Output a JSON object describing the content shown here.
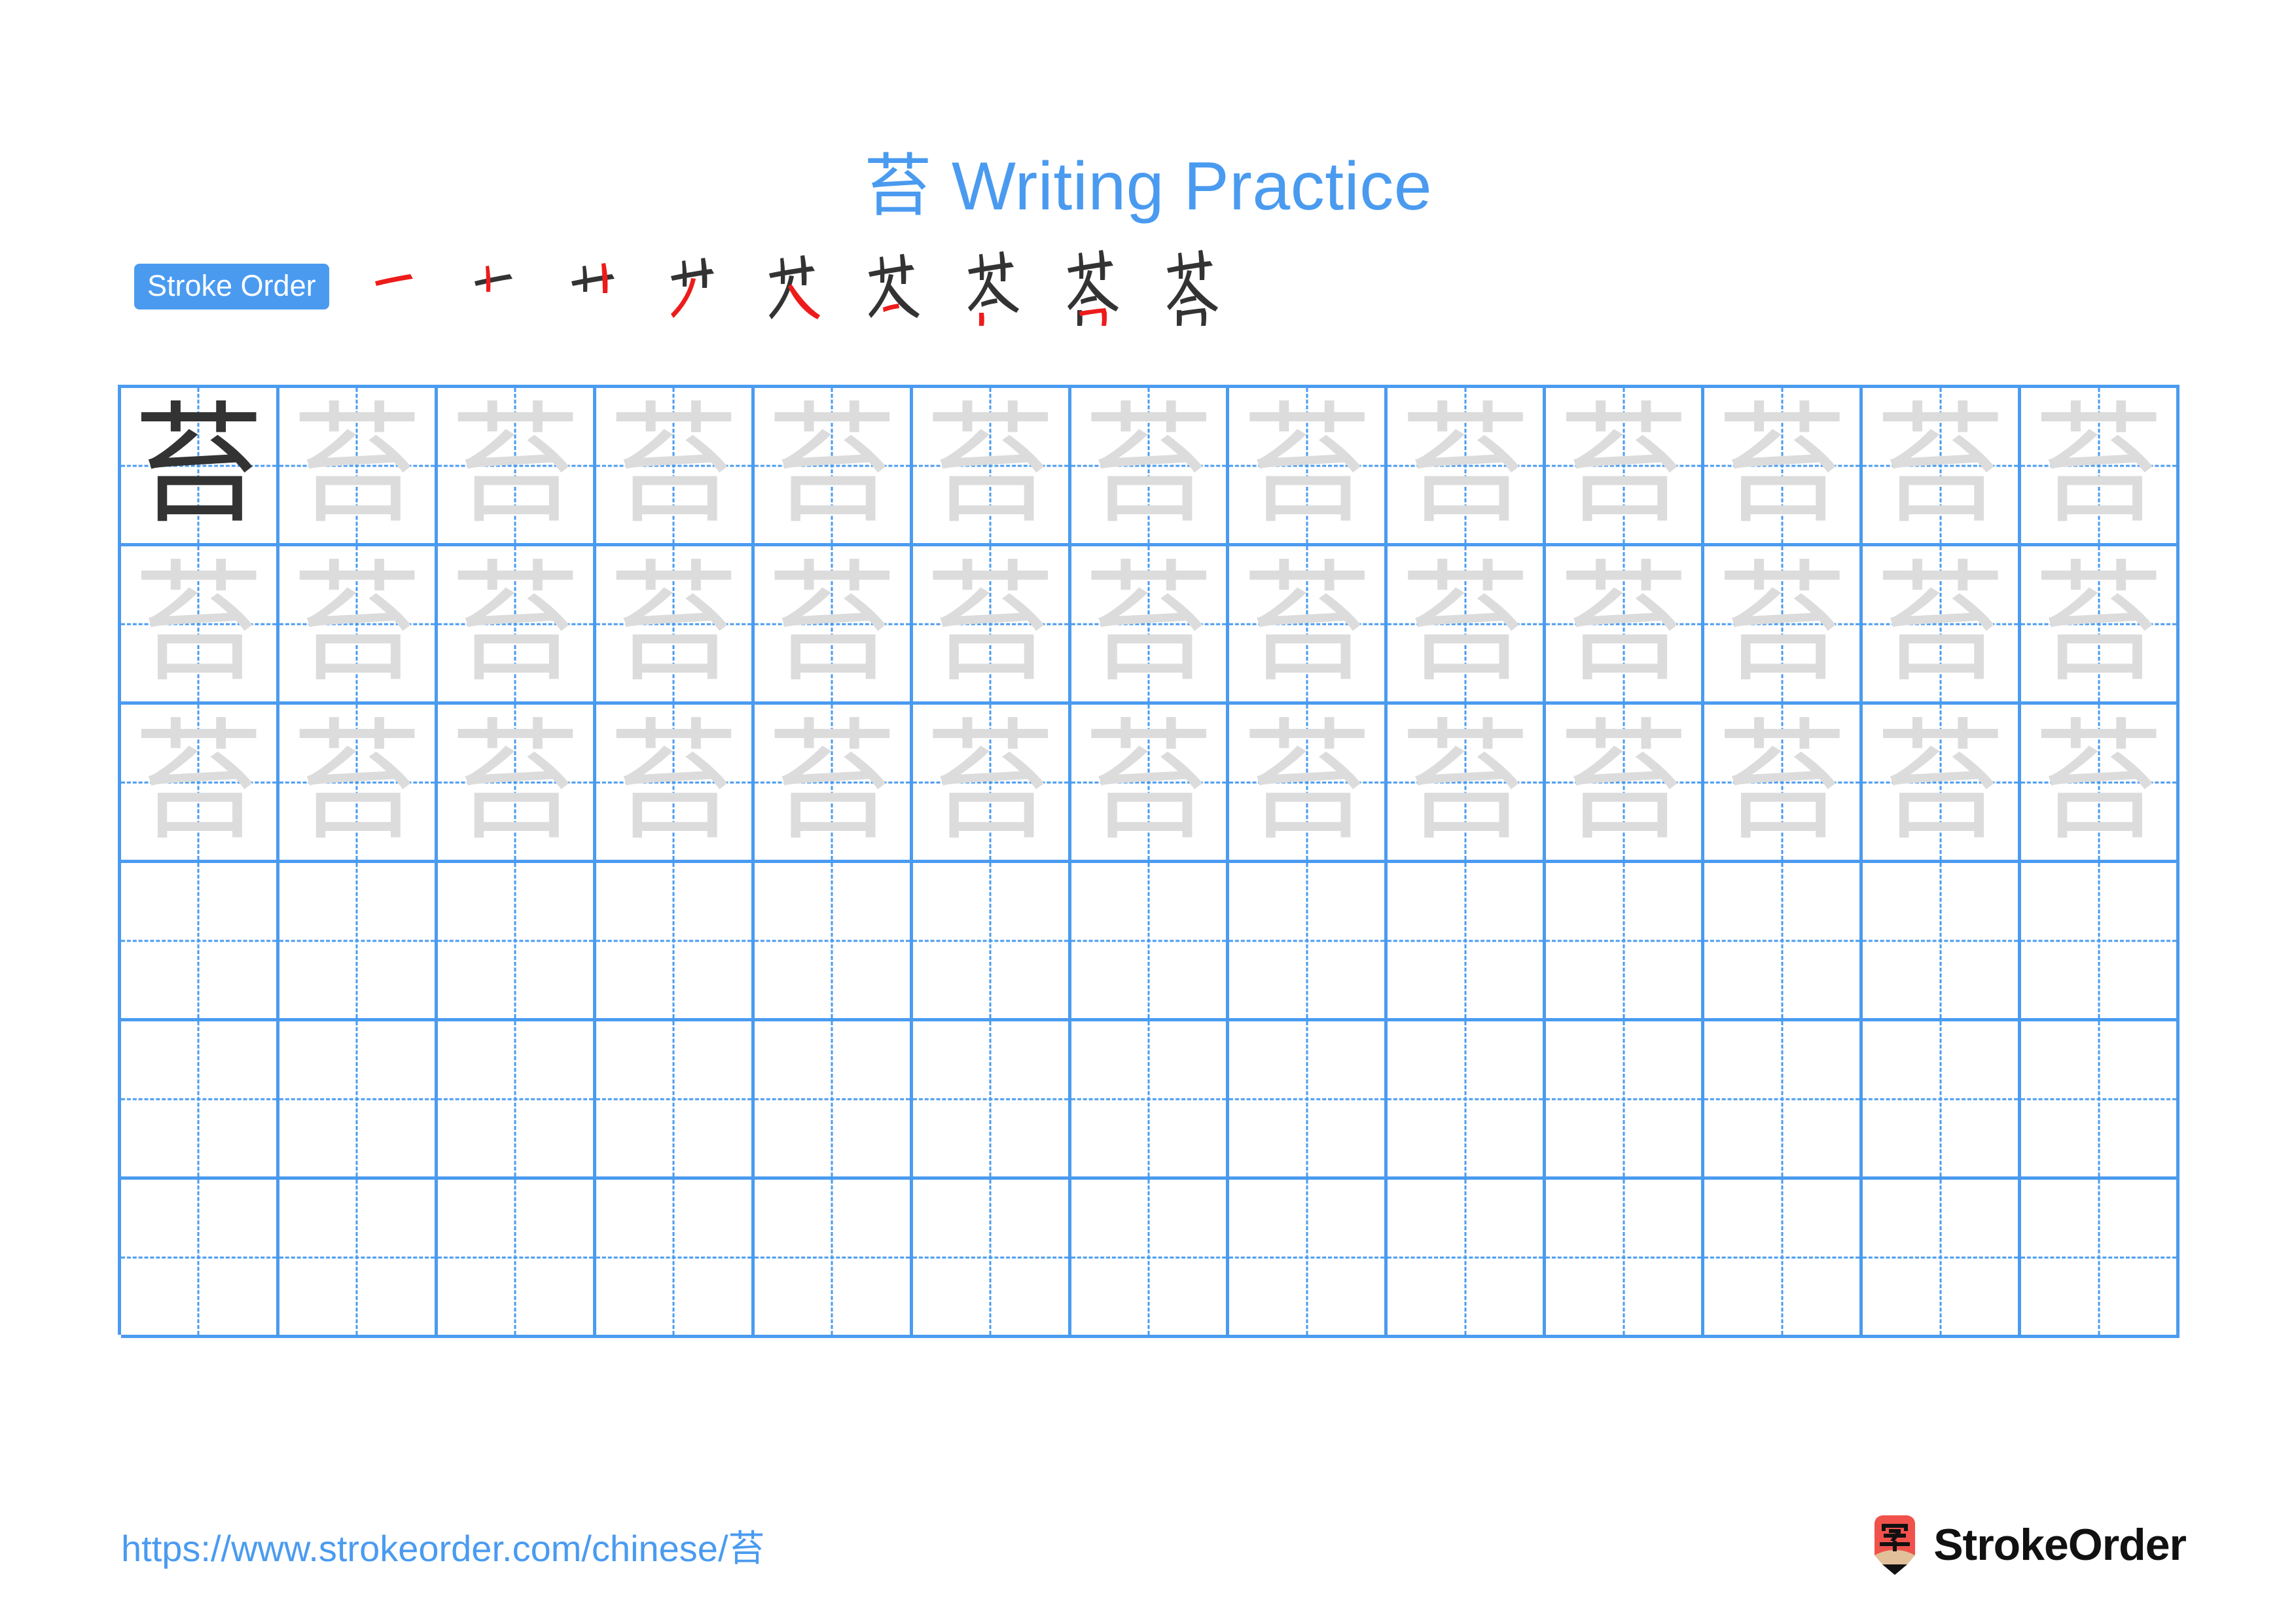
{
  "page": {
    "character": "苔",
    "title_suffix": " Writing Practice",
    "title_full": "苔 Writing Practice",
    "accent_color": "#4A9BF0",
    "trace_color": "#DCDCDC",
    "dark_char_color": "#333333",
    "stroke_new_color": "#EE1B1B",
    "stroke_old_color": "#333333"
  },
  "stroke_order": {
    "label": "Stroke Order",
    "total_strokes": 9,
    "steps": [
      {
        "index": 1,
        "glyph": "一",
        "name": "stroke-step-1"
      },
      {
        "index": 2,
        "glyph": "十",
        "name": "stroke-step-2"
      },
      {
        "index": 3,
        "glyph": "艹",
        "name": "stroke-step-3"
      },
      {
        "index": 4,
        "glyph": "艹丿",
        "name": "stroke-step-4"
      },
      {
        "index": 5,
        "glyph": "艾",
        "name": "stroke-step-5"
      },
      {
        "index": 6,
        "glyph": "芯",
        "name": "stroke-step-6"
      },
      {
        "index": 7,
        "glyph": "芐",
        "name": "stroke-step-7"
      },
      {
        "index": 8,
        "glyph": "苔",
        "name": "stroke-step-8"
      },
      {
        "index": 9,
        "glyph": "苔",
        "name": "stroke-step-9"
      }
    ]
  },
  "grid": {
    "columns": 13,
    "rows": 6,
    "cells": [
      [
        "dark",
        "trace",
        "trace",
        "trace",
        "trace",
        "trace",
        "trace",
        "trace",
        "trace",
        "trace",
        "trace",
        "trace",
        "trace"
      ],
      [
        "trace",
        "trace",
        "trace",
        "trace",
        "trace",
        "trace",
        "trace",
        "trace",
        "trace",
        "trace",
        "trace",
        "trace",
        "trace"
      ],
      [
        "trace",
        "trace",
        "trace",
        "trace",
        "trace",
        "trace",
        "trace",
        "trace",
        "trace",
        "trace",
        "trace",
        "trace",
        "trace"
      ],
      [
        "empty",
        "empty",
        "empty",
        "empty",
        "empty",
        "empty",
        "empty",
        "empty",
        "empty",
        "empty",
        "empty",
        "empty",
        "empty"
      ],
      [
        "empty",
        "empty",
        "empty",
        "empty",
        "empty",
        "empty",
        "empty",
        "empty",
        "empty",
        "empty",
        "empty",
        "empty",
        "empty"
      ],
      [
        "empty",
        "empty",
        "empty",
        "empty",
        "empty",
        "empty",
        "empty",
        "empty",
        "empty",
        "empty",
        "empty",
        "empty",
        "empty"
      ]
    ]
  },
  "footer": {
    "url": "https://www.strokeorder.com/chinese/苔",
    "brand_name": "StrokeOrder",
    "logo_char": "字",
    "logo_body_color": "#F0524B",
    "logo_wood_color": "#E2C19A",
    "logo_tip_color": "#111111"
  }
}
